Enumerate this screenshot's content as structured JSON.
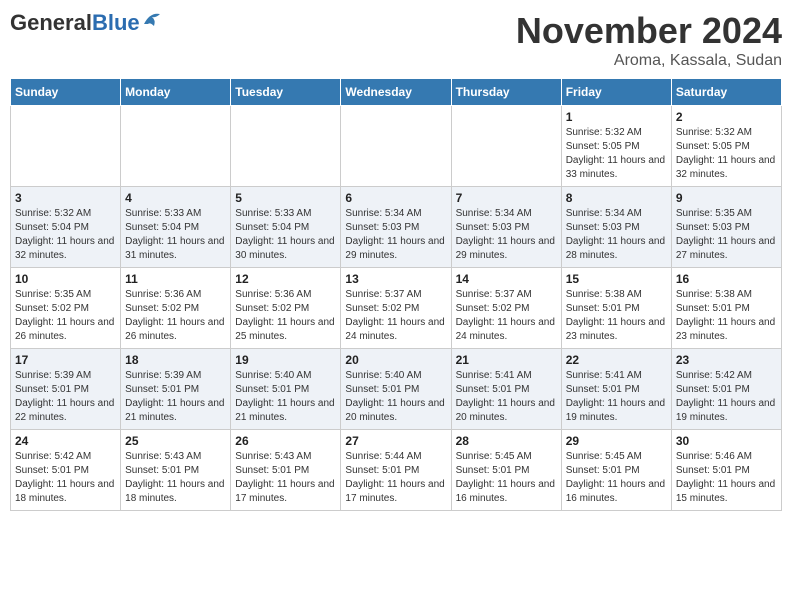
{
  "header": {
    "logo_general": "General",
    "logo_blue": "Blue",
    "month": "November 2024",
    "location": "Aroma, Kassala, Sudan"
  },
  "weekdays": [
    "Sunday",
    "Monday",
    "Tuesday",
    "Wednesday",
    "Thursday",
    "Friday",
    "Saturday"
  ],
  "weeks": [
    [
      {
        "day": "",
        "info": ""
      },
      {
        "day": "",
        "info": ""
      },
      {
        "day": "",
        "info": ""
      },
      {
        "day": "",
        "info": ""
      },
      {
        "day": "",
        "info": ""
      },
      {
        "day": "1",
        "info": "Sunrise: 5:32 AM\nSunset: 5:05 PM\nDaylight: 11 hours\nand 33 minutes."
      },
      {
        "day": "2",
        "info": "Sunrise: 5:32 AM\nSunset: 5:05 PM\nDaylight: 11 hours\nand 32 minutes."
      }
    ],
    [
      {
        "day": "3",
        "info": "Sunrise: 5:32 AM\nSunset: 5:04 PM\nDaylight: 11 hours\nand 32 minutes."
      },
      {
        "day": "4",
        "info": "Sunrise: 5:33 AM\nSunset: 5:04 PM\nDaylight: 11 hours\nand 31 minutes."
      },
      {
        "day": "5",
        "info": "Sunrise: 5:33 AM\nSunset: 5:04 PM\nDaylight: 11 hours\nand 30 minutes."
      },
      {
        "day": "6",
        "info": "Sunrise: 5:34 AM\nSunset: 5:03 PM\nDaylight: 11 hours\nand 29 minutes."
      },
      {
        "day": "7",
        "info": "Sunrise: 5:34 AM\nSunset: 5:03 PM\nDaylight: 11 hours\nand 29 minutes."
      },
      {
        "day": "8",
        "info": "Sunrise: 5:34 AM\nSunset: 5:03 PM\nDaylight: 11 hours\nand 28 minutes."
      },
      {
        "day": "9",
        "info": "Sunrise: 5:35 AM\nSunset: 5:03 PM\nDaylight: 11 hours\nand 27 minutes."
      }
    ],
    [
      {
        "day": "10",
        "info": "Sunrise: 5:35 AM\nSunset: 5:02 PM\nDaylight: 11 hours\nand 26 minutes."
      },
      {
        "day": "11",
        "info": "Sunrise: 5:36 AM\nSunset: 5:02 PM\nDaylight: 11 hours\nand 26 minutes."
      },
      {
        "day": "12",
        "info": "Sunrise: 5:36 AM\nSunset: 5:02 PM\nDaylight: 11 hours\nand 25 minutes."
      },
      {
        "day": "13",
        "info": "Sunrise: 5:37 AM\nSunset: 5:02 PM\nDaylight: 11 hours\nand 24 minutes."
      },
      {
        "day": "14",
        "info": "Sunrise: 5:37 AM\nSunset: 5:02 PM\nDaylight: 11 hours\nand 24 minutes."
      },
      {
        "day": "15",
        "info": "Sunrise: 5:38 AM\nSunset: 5:01 PM\nDaylight: 11 hours\nand 23 minutes."
      },
      {
        "day": "16",
        "info": "Sunrise: 5:38 AM\nSunset: 5:01 PM\nDaylight: 11 hours\nand 23 minutes."
      }
    ],
    [
      {
        "day": "17",
        "info": "Sunrise: 5:39 AM\nSunset: 5:01 PM\nDaylight: 11 hours\nand 22 minutes."
      },
      {
        "day": "18",
        "info": "Sunrise: 5:39 AM\nSunset: 5:01 PM\nDaylight: 11 hours\nand 21 minutes."
      },
      {
        "day": "19",
        "info": "Sunrise: 5:40 AM\nSunset: 5:01 PM\nDaylight: 11 hours\nand 21 minutes."
      },
      {
        "day": "20",
        "info": "Sunrise: 5:40 AM\nSunset: 5:01 PM\nDaylight: 11 hours\nand 20 minutes."
      },
      {
        "day": "21",
        "info": "Sunrise: 5:41 AM\nSunset: 5:01 PM\nDaylight: 11 hours\nand 20 minutes."
      },
      {
        "day": "22",
        "info": "Sunrise: 5:41 AM\nSunset: 5:01 PM\nDaylight: 11 hours\nand 19 minutes."
      },
      {
        "day": "23",
        "info": "Sunrise: 5:42 AM\nSunset: 5:01 PM\nDaylight: 11 hours\nand 19 minutes."
      }
    ],
    [
      {
        "day": "24",
        "info": "Sunrise: 5:42 AM\nSunset: 5:01 PM\nDaylight: 11 hours\nand 18 minutes."
      },
      {
        "day": "25",
        "info": "Sunrise: 5:43 AM\nSunset: 5:01 PM\nDaylight: 11 hours\nand 18 minutes."
      },
      {
        "day": "26",
        "info": "Sunrise: 5:43 AM\nSunset: 5:01 PM\nDaylight: 11 hours\nand 17 minutes."
      },
      {
        "day": "27",
        "info": "Sunrise: 5:44 AM\nSunset: 5:01 PM\nDaylight: 11 hours\nand 17 minutes."
      },
      {
        "day": "28",
        "info": "Sunrise: 5:45 AM\nSunset: 5:01 PM\nDaylight: 11 hours\nand 16 minutes."
      },
      {
        "day": "29",
        "info": "Sunrise: 5:45 AM\nSunset: 5:01 PM\nDaylight: 11 hours\nand 16 minutes."
      },
      {
        "day": "30",
        "info": "Sunrise: 5:46 AM\nSunset: 5:01 PM\nDaylight: 11 hours\nand 15 minutes."
      }
    ]
  ]
}
